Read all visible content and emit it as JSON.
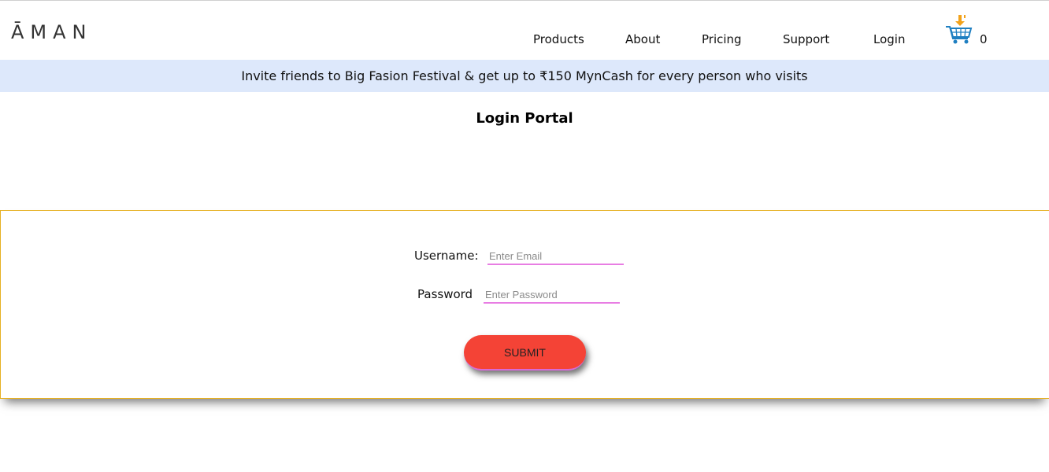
{
  "header": {
    "logo": "ĀMAN",
    "nav": [
      "Products",
      "About",
      "Pricing",
      "Support",
      "Login"
    ],
    "cart_count": "0"
  },
  "banner": {
    "text": "Invite friends to Big Fasion Festival & get up to ₹150 MynCash for every person who visits"
  },
  "main": {
    "title": "Login Portal"
  },
  "login_form": {
    "username_label": "Username:",
    "username_placeholder": "Enter Email",
    "password_label": "Password",
    "password_placeholder": "Enter Password",
    "submit_label": "SUBMIT"
  },
  "colors": {
    "banner_bg": "#dde8fb",
    "panel_border": "#e6b022",
    "input_underline": "#e87de3",
    "submit_bg": "#f44336"
  }
}
